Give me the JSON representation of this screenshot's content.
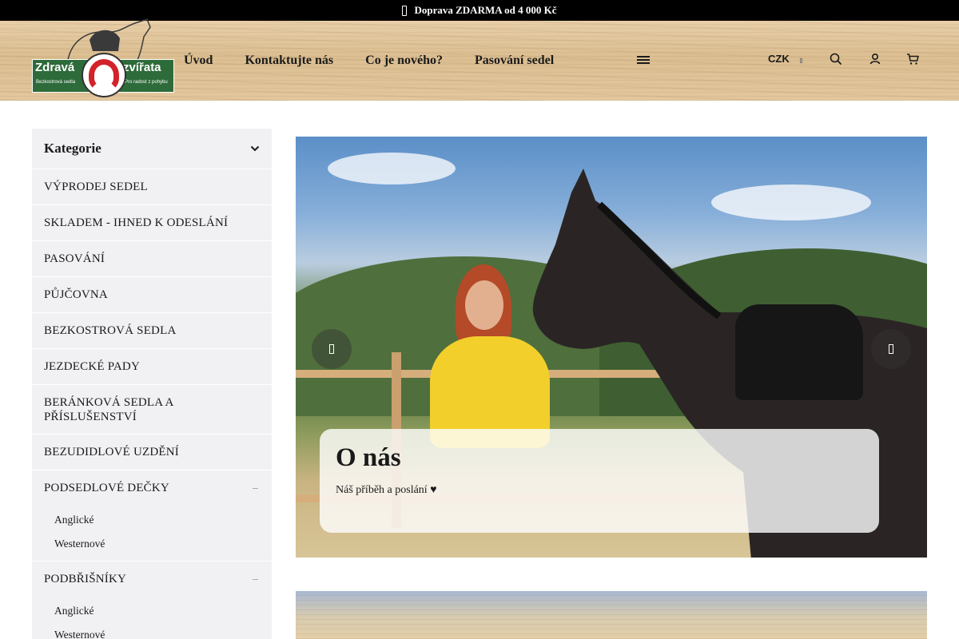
{
  "topbar": {
    "shipping_text": "Doprava ZDARMA od 4 000 Kč",
    "icon": "info-box-icon"
  },
  "logo": {
    "word1": "Zdravá",
    "word2": "zvířata",
    "tagline1": "Bezkostrová sedla",
    "tagline2": "Pro radost z pohybu",
    "colors": {
      "plate": "#2e6b3a",
      "horseshoe": "#d2232a"
    }
  },
  "nav": {
    "items": [
      "Úvod",
      "Kontaktujte nás",
      "Co je nového?",
      "Pasování sedel"
    ],
    "more_icon": "hamburger-icon"
  },
  "header_tools": {
    "currency": "CZK",
    "icons": [
      "search-icon",
      "user-icon",
      "cart-icon"
    ]
  },
  "sidebar": {
    "title": "Kategorie",
    "items": [
      "VÝPRODEJ SEDEL",
      "SKLADEM - IHNED K ODESLÁNÍ",
      "PASOVÁNÍ",
      "PŮJČOVNA",
      "BEZKOSTROVÁ SEDLA",
      "JEZDECKÉ PADY",
      "BERÁNKOVÁ SEDLA A PŘÍSLUŠENSTVÍ",
      "BEZUDIDLOVÉ UZDĚNÍ"
    ],
    "groups": [
      {
        "label": "PODSEDLOVÉ DEČKY",
        "subitems": [
          "Anglické",
          "Westernové"
        ]
      },
      {
        "label": "PODBŘIŠNÍKY",
        "subitems": [
          "Anglické",
          "Westernové"
        ]
      }
    ]
  },
  "hero": {
    "title": "O nás",
    "subtitle": "Náš příběh a poslání ♥",
    "prev_icon": "chevron-left-icon",
    "next_icon": "chevron-right-icon"
  }
}
